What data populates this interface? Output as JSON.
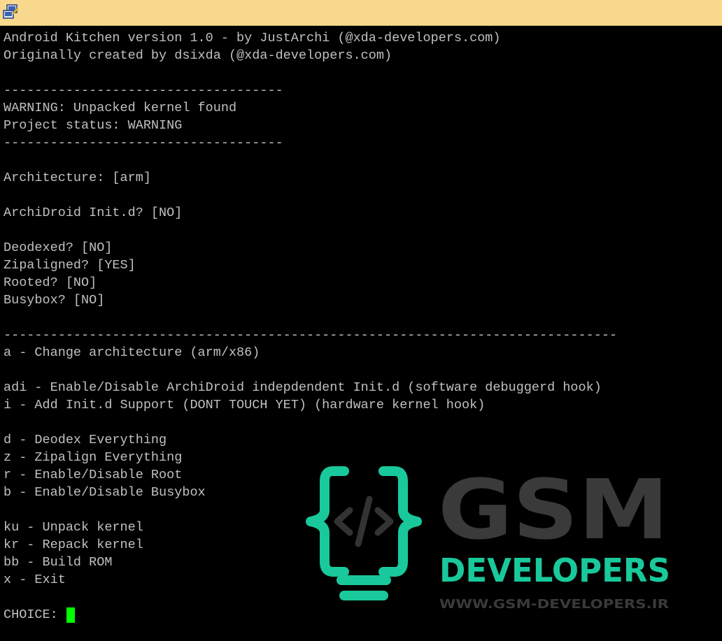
{
  "window": {
    "icon": "terminal-app-icon"
  },
  "terminal": {
    "lines": [
      "Android Kitchen version 1.0 - by JustArchi (@xda-developers.com)",
      "Originally created by dsixda (@xda-developers.com)",
      "",
      "------------------------------------",
      "WARNING: Unpacked kernel found",
      "Project status: WARNING",
      "------------------------------------",
      "",
      "Architecture: [arm]",
      "",
      "ArchiDroid Init.d? [NO]",
      "",
      "Deodexed? [NO]",
      "Zipaligned? [YES]",
      "Rooted? [NO]",
      "Busybox? [NO]",
      "",
      "-------------------------------------------------------------------------------",
      "a - Change architecture (arm/x86)",
      "",
      "adi - Enable/Disable ArchiDroid indepdendent Init.d (software debuggerd hook)",
      "i - Add Init.d Support (DONT TOUCH YET) (hardware kernel hook)",
      "",
      "d - Deodex Everything",
      "z - Zipalign Everything",
      "r - Enable/Disable Root",
      "b - Enable/Disable Busybox",
      "",
      "ku - Unpack kernel",
      "kr - Repack kernel",
      "bb - Build ROM",
      "x - Exit",
      ""
    ],
    "prompt": "CHOICE:",
    "text_color": "#c0c0c0",
    "cursor_color": "#00ff00"
  },
  "watermark": {
    "brand": "GSM",
    "sub": "DEVELOPERS",
    "url": "WWW.GSM-DEVELOPERS.IR",
    "icon": "code-bulb-icon",
    "brand_color": "#3a3a3a",
    "accent_color": "#19c99b"
  }
}
